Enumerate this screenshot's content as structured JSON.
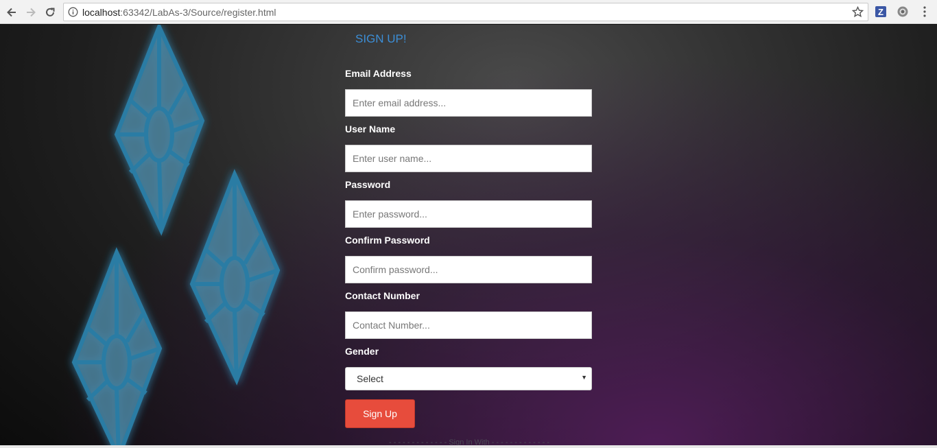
{
  "browser": {
    "url_host": "localhost",
    "url_rest": ":63342/LabAs-3/Source/register.html",
    "extension_label": "Z",
    "icons": {
      "back": "back-arrow-icon",
      "forward": "forward-arrow-icon",
      "reload": "reload-icon",
      "info": "info-icon",
      "star": "star-icon",
      "menu": "kebab-menu-icon"
    }
  },
  "form": {
    "title": "SIGN UP!",
    "fields": [
      {
        "label": "Email Address",
        "placeholder": "Enter email address..."
      },
      {
        "label": "User Name",
        "placeholder": "Enter user name..."
      },
      {
        "label": "Password",
        "placeholder": "Enter password..."
      },
      {
        "label": "Confirm Password",
        "placeholder": "Confirm password..."
      },
      {
        "label": "Contact Number",
        "placeholder": "Contact Number..."
      }
    ],
    "gender": {
      "label": "Gender",
      "selected": "Select"
    },
    "submit_label": "Sign Up",
    "divider_text": "- - - - - - - - - - - - - Sign In With - - - - - - - - - - - - -"
  },
  "colors": {
    "accent": "#3c8ed6",
    "button": "#e74c3c",
    "gem": "#3a8bb0"
  }
}
